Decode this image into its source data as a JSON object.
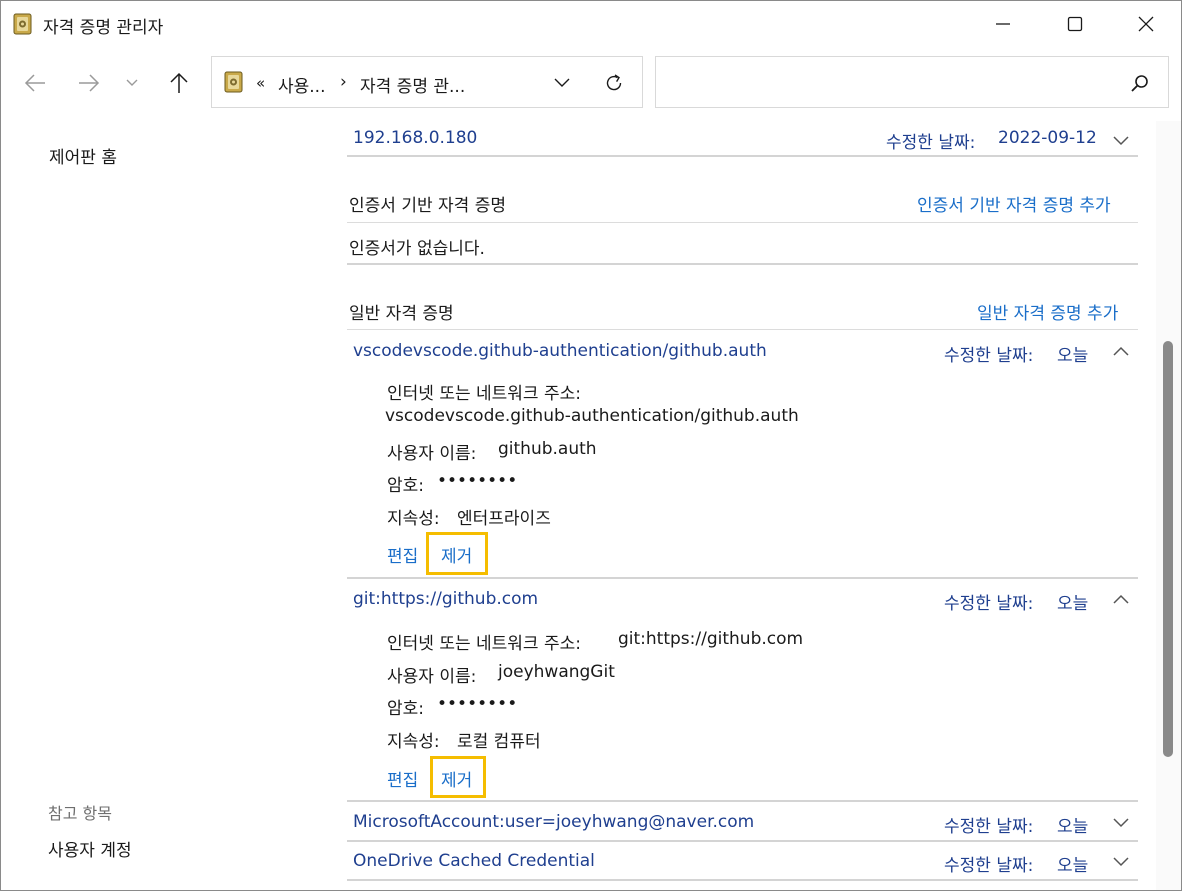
{
  "window": {
    "title": "자격 증명 관리자"
  },
  "address": {
    "prefix": "«",
    "segment1": "사용...",
    "separator": "›",
    "segment2": "자격 증명 관..."
  },
  "search": {
    "placeholder": ""
  },
  "left_pane": {
    "home": "제어판 홈",
    "see_also": "참고 항목",
    "user_accounts": "사용자 계정"
  },
  "top_item": {
    "name": "192.168.0.180",
    "modified_label": "수정한 날짜:",
    "modified_value": "2022-09-12"
  },
  "cert_section": {
    "title": "인증서 기반 자격 증명",
    "add_link": "인증서 기반 자격 증명 추가",
    "empty_text": "인증서가 없습니다."
  },
  "generic_section": {
    "title": "일반 자격 증명",
    "add_link": "일반 자격 증명 추가"
  },
  "credentials": [
    {
      "name": "vscodevscode.github-authentication/github.auth",
      "modified_label": "수정한 날짜:",
      "modified_value": "오늘",
      "address_label": "인터넷 또는 네트워크 주소:",
      "address_value": "vscodevscode.github-authentication/github.auth",
      "user_label": "사용자 이름:",
      "user_value": "github.auth",
      "password_label": "암호:",
      "password_value": "••••••••",
      "persistence_label": "지속성:",
      "persistence_value": "엔터프라이즈",
      "edit": "편집",
      "remove": "제거"
    },
    {
      "name": "git:https://github.com",
      "modified_label": "수정한 날짜:",
      "modified_value": "오늘",
      "address_label": "인터넷 또는 네트워크 주소:",
      "address_value": "git:https://github.com",
      "user_label": "사용자 이름:",
      "user_value": "joeyhwangGit",
      "password_label": "암호:",
      "password_value": "••••••••",
      "persistence_label": "지속성:",
      "persistence_value": "로컬 컴퓨터",
      "edit": "편집",
      "remove": "제거"
    },
    {
      "name": "MicrosoftAccount:user=joeyhwang@naver.com",
      "modified_label": "수정한 날짜:",
      "modified_value": "오늘"
    },
    {
      "name": "OneDrive Cached Credential",
      "modified_label": "수정한 날짜:",
      "modified_value": "오늘"
    }
  ],
  "colors": {
    "link": "#1f3f8f",
    "action_link": "#1a6ec9",
    "highlight": "#f5bd00"
  },
  "icons": {
    "app": "credential-vault-icon",
    "minimize": "minimize-icon",
    "maximize": "maximize-icon",
    "close": "close-icon",
    "back": "back-arrow-icon",
    "forward": "forward-arrow-icon",
    "recent": "chevron-down-icon",
    "up": "up-arrow-icon",
    "refresh": "refresh-icon",
    "search": "search-icon",
    "expand": "chevron-down-icon",
    "collapse": "chevron-up-icon"
  }
}
